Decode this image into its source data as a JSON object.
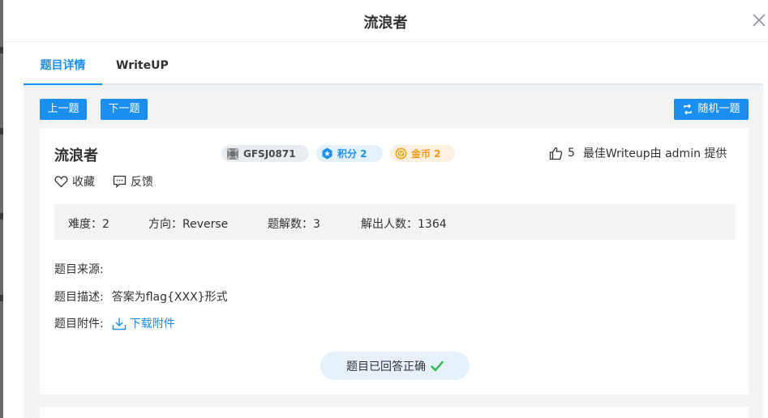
{
  "dialog": {
    "title": "流浪者"
  },
  "tabs": [
    {
      "label": "题目详情",
      "active": true
    },
    {
      "label": "WriteUP",
      "active": false
    }
  ],
  "nav_buttons": {
    "prev": "上一题",
    "next": "下一题",
    "random": "随机一题"
  },
  "problem": {
    "title": "流浪者",
    "tags": {
      "id": "GFSJ0871",
      "score": "积分 2",
      "coin": "金币 2"
    },
    "likes": "5",
    "writeup_credit": "最佳Writeup由 admin 提供",
    "actions": {
      "favorite": "收藏",
      "feedback": "反馈"
    },
    "stats": {
      "difficulty": "难度：2",
      "direction": "方向：Reverse",
      "solutions": "题解数：3",
      "solvers": "解出人数：1364"
    },
    "info": {
      "source_label": "题目来源:",
      "source_value": "",
      "desc_label": "题目描述:",
      "desc_value": "答案为flag{XXX}形式",
      "attach_label": "题目附件:",
      "attach_link": "下载附件"
    },
    "answered_status": "题目已回答正确"
  },
  "colors": {
    "accent": "#1a8ff0",
    "success": "#2fb84a",
    "coin": "#f09a1a"
  },
  "icons": [
    "close-icon",
    "swap-icon",
    "badge-icon",
    "star-badge-icon",
    "coin-icon",
    "thumbs-up-icon",
    "heart-icon",
    "message-icon",
    "download-icon",
    "check-icon"
  ]
}
